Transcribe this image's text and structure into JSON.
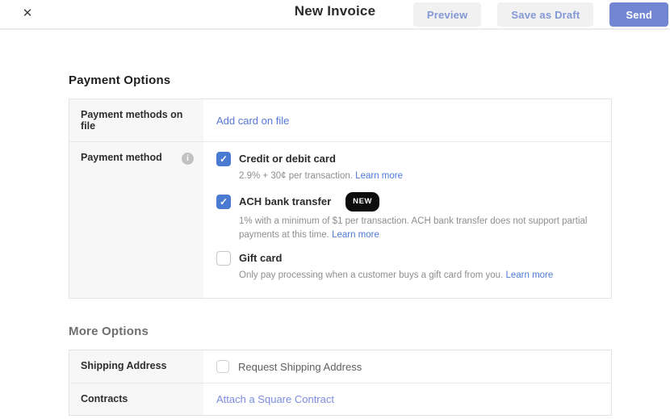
{
  "colors": {
    "accent_checkbox_blue": "#4a7ad1",
    "send_button_blue": "#7386d3",
    "secondary_button_text": "#8398d5",
    "link_blue": "#5678d8",
    "badge_black": "#0d0d0d",
    "table_border": "#e3e3e3",
    "label_cell_bg": "#f7f7f7"
  },
  "icons": {
    "close": "✕",
    "check": "✓",
    "info": "i"
  },
  "header": {
    "title": "New Invoice",
    "buttons": {
      "preview": "Preview",
      "save_as_draft": "Save as Draft",
      "send": "Send"
    }
  },
  "payment_options": {
    "heading": "Payment Options",
    "methods_on_file": {
      "label": "Payment methods on file",
      "link": "Add card on file"
    },
    "payment_method": {
      "label": "Payment method",
      "options": [
        {
          "label": "Credit or debit card",
          "checked": true,
          "description": "2.9% + 30¢ per transaction.",
          "link": "Learn more"
        },
        {
          "label": "ACH bank transfer",
          "badge": "NEW",
          "checked": true,
          "description": "1% with a minimum of $1 per transaction. ACH bank transfer does not support partial payments at this time.",
          "link": "Learn more"
        },
        {
          "label": "Gift card",
          "checked": false,
          "description": "Only pay processing when a customer buys a gift card from you.",
          "link": "Learn more"
        }
      ]
    }
  },
  "more_options": {
    "heading": "More Options",
    "shipping": {
      "label": "Shipping Address",
      "checkbox_label": "Request Shipping Address",
      "checked": false
    },
    "contracts": {
      "label": "Contracts",
      "link": "Attach a Square Contract"
    }
  }
}
